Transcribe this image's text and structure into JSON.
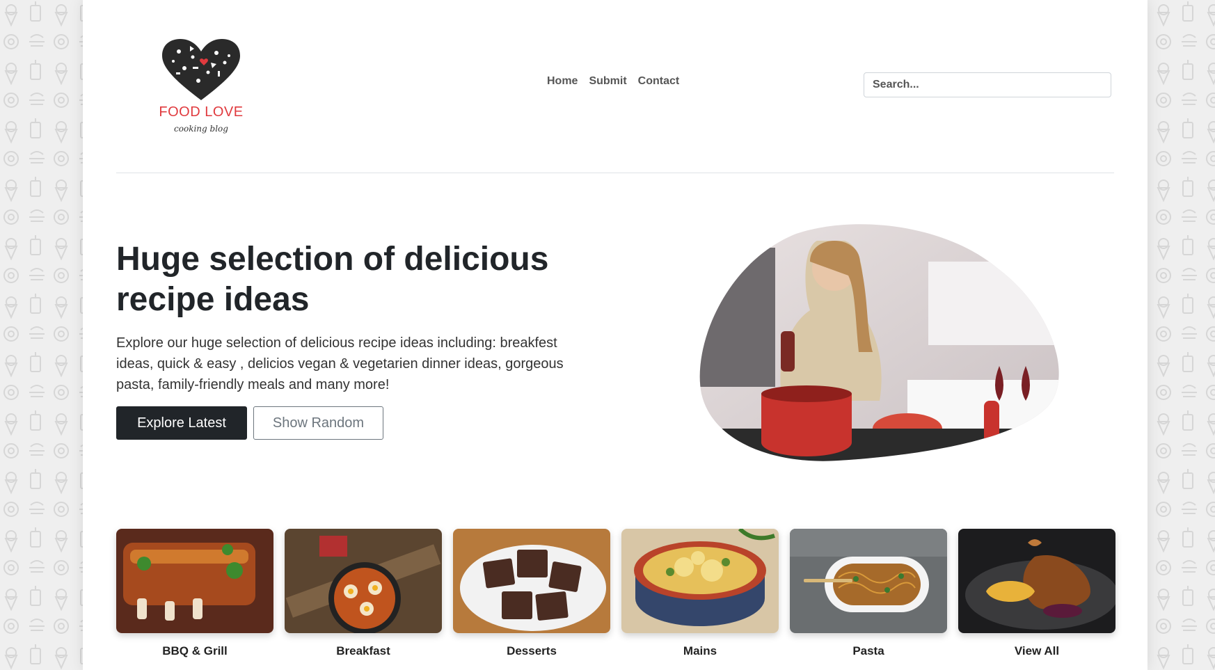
{
  "brand": {
    "name": "FOOD LOVE",
    "tagline": "cooking blog"
  },
  "nav": {
    "items": [
      {
        "label": "Home"
      },
      {
        "label": "Submit"
      },
      {
        "label": "Contact"
      }
    ]
  },
  "search": {
    "placeholder": "Search..."
  },
  "hero": {
    "title": "Huge selection of delicious recipe ideas",
    "text": "Explore our huge selection of delicious recipe ideas including: breakfest ideas, quick & easy , delicios vegan & vegetarien dinner ideas, gorgeous pasta, family-friendly meals and many more!",
    "primary_button": "Explore Latest",
    "secondary_button": "Show Random"
  },
  "categories": [
    {
      "label": "BBQ & Grill"
    },
    {
      "label": "Breakfast"
    },
    {
      "label": "Desserts"
    },
    {
      "label": "Mains"
    },
    {
      "label": "Pasta"
    },
    {
      "label": "View All"
    }
  ],
  "colors": {
    "brand_red": "#e03a3e",
    "dark": "#212529",
    "muted": "#6c757d"
  }
}
